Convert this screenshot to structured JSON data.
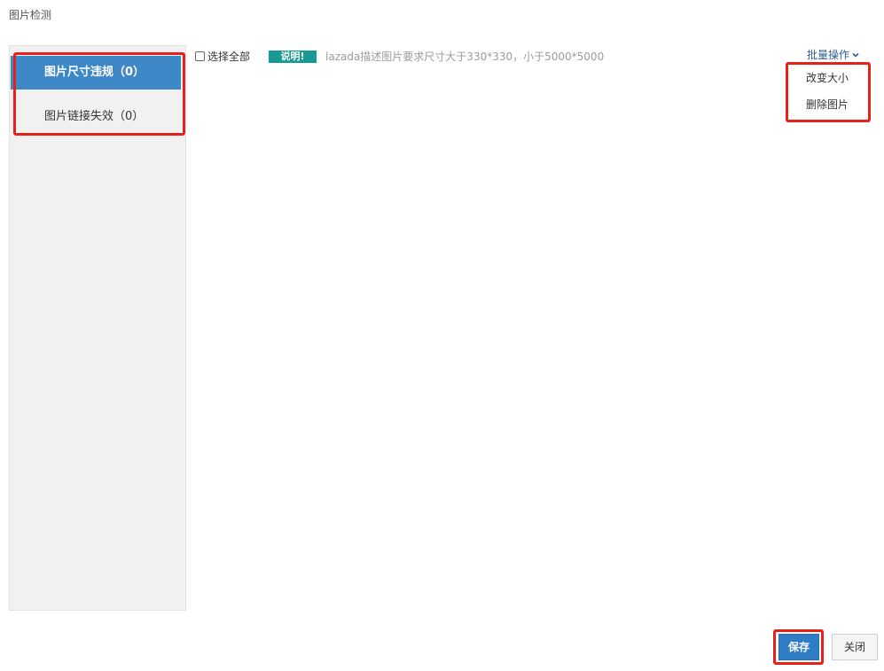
{
  "dialog": {
    "title": "图片检测"
  },
  "sidebar": {
    "items": [
      {
        "label": "图片尺寸违规（0）"
      },
      {
        "label": "图片链接失效（0）"
      }
    ]
  },
  "toolbar": {
    "select_all_label": "选择全部",
    "note_badge": "说明!",
    "note_text": "lazada描述图片要求尺寸大于330*330，小于5000*5000",
    "batch_ops_label": "批量操作",
    "dropdown": [
      {
        "label": "改变大小"
      },
      {
        "label": "删除图片"
      }
    ]
  },
  "footer": {
    "save_label": "保存",
    "close_label": "关闭"
  },
  "colors": {
    "active_tab": "#3f88c8",
    "badge": "#179a93",
    "highlight": "#e8201a",
    "primary_button": "#2f7dc4"
  }
}
